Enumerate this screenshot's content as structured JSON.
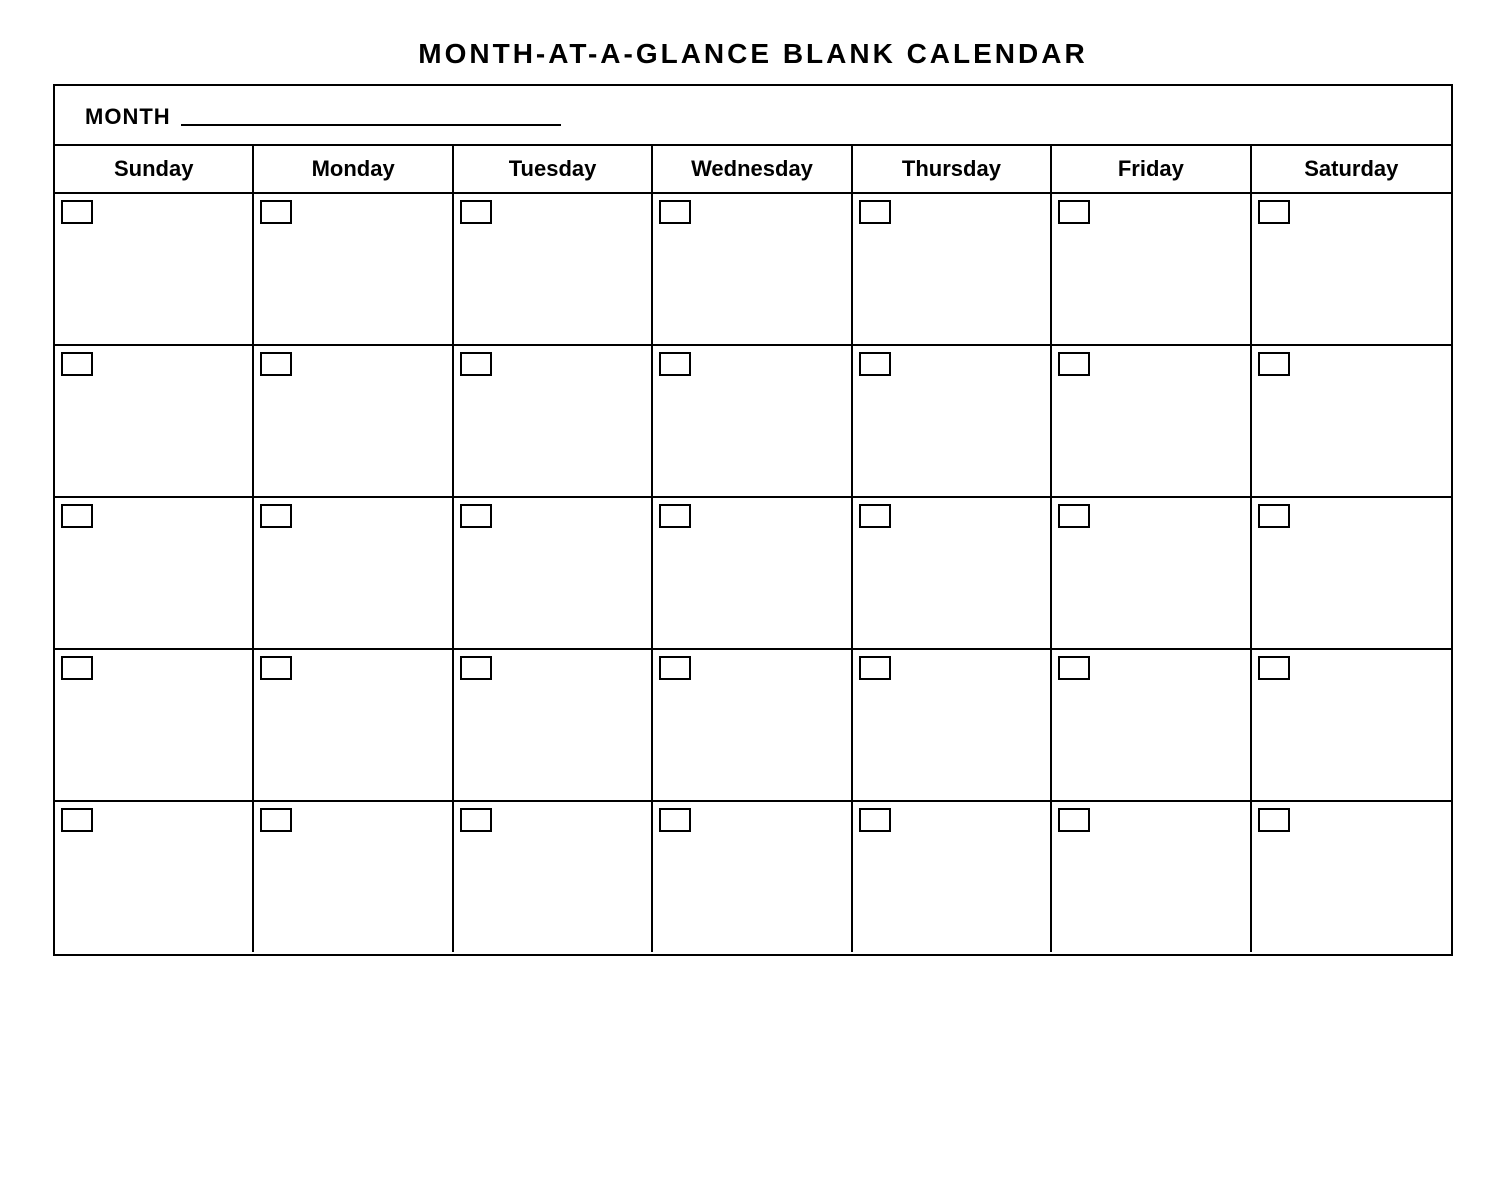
{
  "title": "MONTH-AT-A-GLANCE  BLANK  CALENDAR",
  "month_label": "MONTH",
  "days": [
    "Sunday",
    "Monday",
    "Tuesday",
    "Wednesday",
    "Thursday",
    "Friday",
    "Saturday"
  ],
  "weeks": 5,
  "colors": {
    "border": "#000000",
    "background": "#ffffff",
    "text": "#000000"
  }
}
